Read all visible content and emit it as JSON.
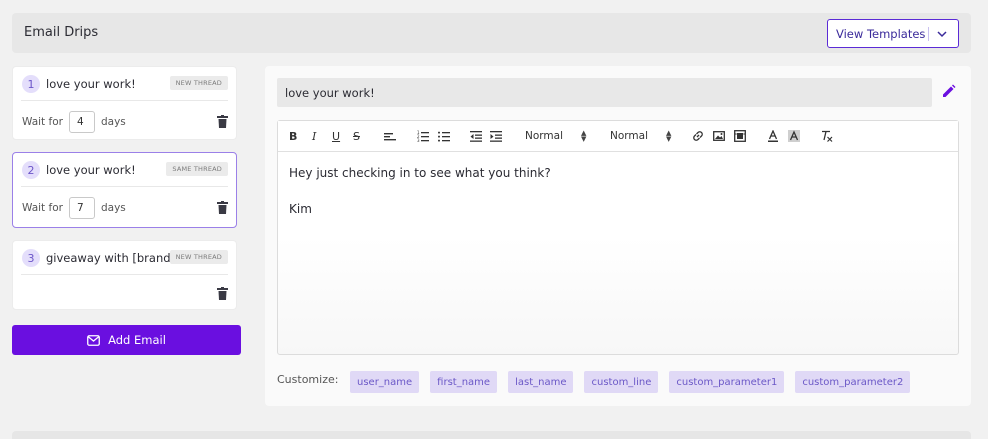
{
  "header": {
    "title": "Email Drips",
    "view_templates_label": "View Templates"
  },
  "drips": [
    {
      "number": "1",
      "subject": "love your work!",
      "badge": "NEW THREAD",
      "wait_label": "Wait for",
      "wait_value": "4",
      "wait_unit": "days"
    },
    {
      "number": "2",
      "subject": "love your work!",
      "badge": "SAME THREAD",
      "wait_label": "Wait for",
      "wait_value": "7",
      "wait_unit": "days"
    },
    {
      "number": "3",
      "subject": "giveaway with [brand]",
      "badge": "NEW THREAD"
    }
  ],
  "add_email_label": "Add Email",
  "editor": {
    "subject_value": "love your work!",
    "toolbar": {
      "bold": "B",
      "italic": "I",
      "underline": "U",
      "strike": "S",
      "heading_select": "Normal",
      "size_select": "Normal"
    },
    "body_lines": [
      "Hey just checking in to see what you think?",
      "",
      "Kim"
    ]
  },
  "customize": {
    "label": "Customize:",
    "chips": [
      "user_name",
      "first_name",
      "last_name",
      "custom_line",
      "custom_parameter1",
      "custom_parameter2"
    ]
  },
  "colors": {
    "accent": "#6a0fe0",
    "chip_bg": "#e0d9f6",
    "chip_text": "#6b58c7"
  }
}
